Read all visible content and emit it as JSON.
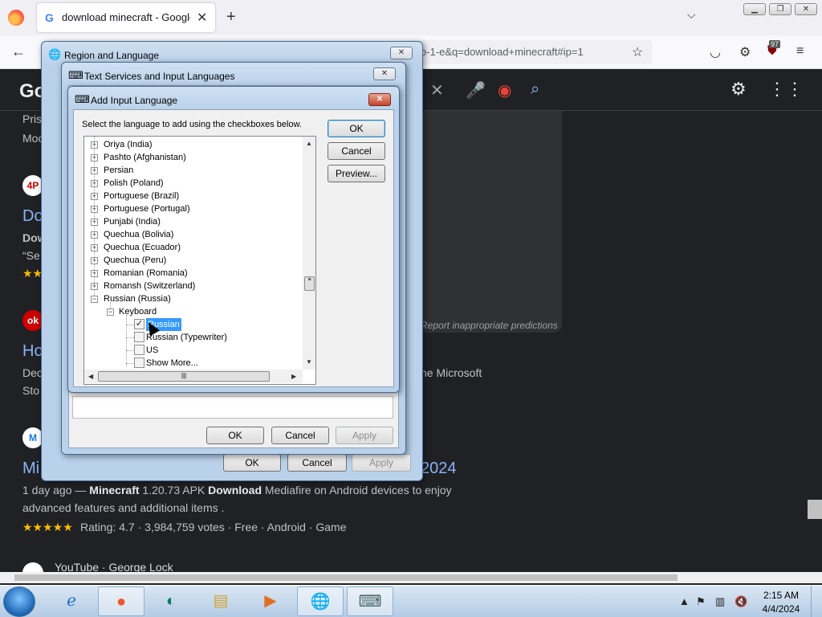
{
  "browser": {
    "tab_title": "download minecraft - Google S",
    "tab_favicon": "G",
    "url": "o-1-e&q=download+minecraft#ip=1",
    "extension_badge": "97"
  },
  "google": {
    "logo": "Go",
    "snippet_top": [
      "Pris",
      "Moc"
    ],
    "result1_link": "Do",
    "result1_bold": "Dow",
    "result1_quote": "“Se",
    "result2_link": "Ho",
    "result2_text": "Dec",
    "result2_text_right": "he Microsoft",
    "result2_text2": "Sto",
    "report": "Report inappropriate predictions",
    "result3_link_left": "Mi",
    "result3_link_right": "2024",
    "result3_meta": "1 day ago — ",
    "result3_bold1": "Minecraft",
    "result3_mid": " 1.20.73 APK ",
    "result3_bold2": "Download",
    "result3_rest": " Mediafire on Android devices to enjoy",
    "result3_line2": "advanced features and additional items .",
    "result3_rating": "Rating: 4.7 · 3,984,759 votes · Free · Android · Game",
    "result4_source": "YouTube · George Lock"
  },
  "region_dialog": {
    "title": "Region and Language",
    "ok": "OK",
    "cancel": "Cancel",
    "apply": "Apply"
  },
  "text_services_dialog": {
    "title": "Text Services and Input Languages",
    "ok": "OK",
    "cancel": "Cancel",
    "apply": "Apply"
  },
  "add_input_dialog": {
    "title": "Add Input Language",
    "instruction": "Select the language to add using the checkboxes below.",
    "ok": "OK",
    "cancel": "Cancel",
    "preview": "Preview...",
    "languages": [
      "Oriya (India)",
      "Pashto (Afghanistan)",
      "Persian",
      "Polish (Poland)",
      "Portuguese (Brazil)",
      "Portuguese (Portugal)",
      "Punjabi (India)",
      "Quechua (Bolivia)",
      "Quechua (Ecuador)",
      "Quechua (Peru)",
      "Romanian (Romania)",
      "Romansh (Switzerland)",
      "Russian (Russia)"
    ],
    "keyboard_label": "Keyboard",
    "keyboards": [
      {
        "label": "Russian",
        "checked": true
      },
      {
        "label": "Russian (Typewriter)",
        "checked": false
      },
      {
        "label": "US",
        "checked": false
      },
      {
        "label": "Show More...",
        "checked": false
      }
    ]
  },
  "taskbar": {
    "time": "2:15 AM",
    "date": "4/4/2024"
  }
}
